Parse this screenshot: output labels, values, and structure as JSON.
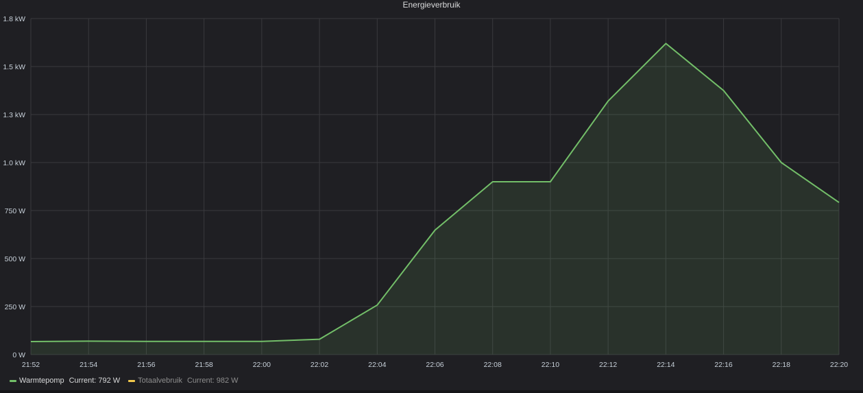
{
  "panel": {
    "title": "Energieverbruik"
  },
  "colors": {
    "background": "#1f1f23",
    "grid": "#3a3a3e",
    "text": "#c7d0d9",
    "warmtepomp": "#73bf69",
    "totaalverbruik": "#f2c94c"
  },
  "chart_data": {
    "type": "area",
    "title": "Energieverbruik",
    "xlabel": "",
    "ylabel": "",
    "x": [
      "21:52",
      "21:54",
      "21:56",
      "21:58",
      "22:00",
      "22:02",
      "22:04",
      "22:06",
      "22:08",
      "22:10",
      "22:12",
      "22:14",
      "22:16",
      "22:18",
      "22:20"
    ],
    "x_ticks": [
      "21:52",
      "21:54",
      "21:56",
      "21:58",
      "22:00",
      "22:02",
      "22:04",
      "22:06",
      "22:08",
      "22:10",
      "22:12",
      "22:14",
      "22:16",
      "22:18",
      "22:20"
    ],
    "y_ticks": [
      {
        "value": 0,
        "label": "0 W"
      },
      {
        "value": 250,
        "label": "250 W"
      },
      {
        "value": 500,
        "label": "500 W"
      },
      {
        "value": 750,
        "label": "750 W"
      },
      {
        "value": 1000,
        "label": "1.0 kW"
      },
      {
        "value": 1250,
        "label": "1.3 kW"
      },
      {
        "value": 1500,
        "label": "1.5 kW"
      },
      {
        "value": 1750,
        "label": "1.8 kW"
      }
    ],
    "ylim": [
      0,
      1750
    ],
    "grid": true,
    "legend_position": "bottom-left",
    "series": [
      {
        "name": "Warmtepomp",
        "color": "#73bf69",
        "visible": true,
        "values": [
          68,
          70,
          69,
          69,
          69,
          80,
          258,
          648,
          900,
          900,
          1320,
          1620,
          1375,
          1000,
          792
        ]
      }
    ]
  },
  "legend": {
    "items": [
      {
        "name": "Warmtepomp",
        "stat_label": "Current:",
        "stat_value": "792 W",
        "color": "#73bf69"
      },
      {
        "name": "Totaalvebruik",
        "stat_label": "Current:",
        "stat_value": "982 W",
        "color": "#f2c94c"
      }
    ]
  }
}
